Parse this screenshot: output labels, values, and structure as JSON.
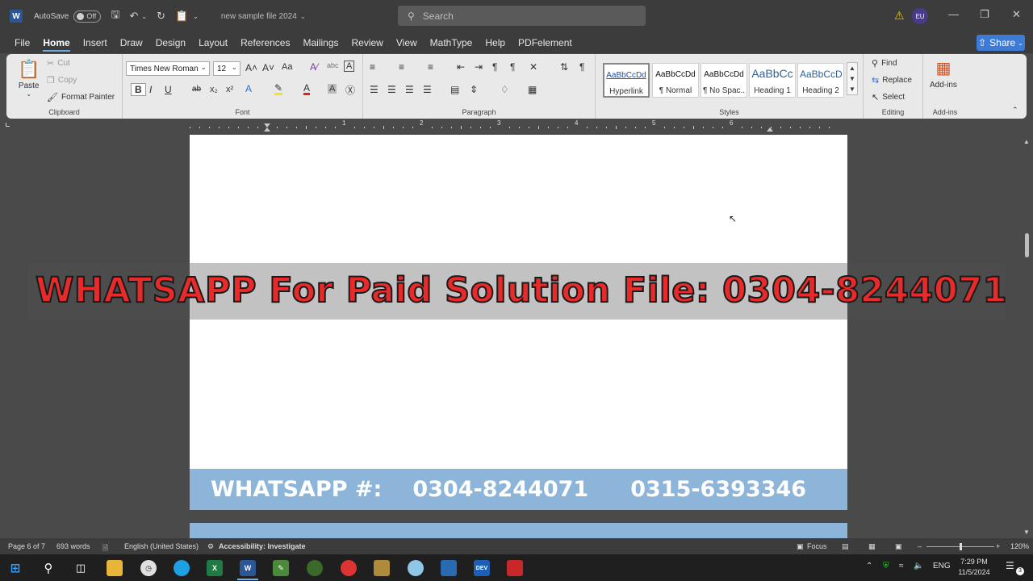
{
  "titlebar": {
    "app_icon": "W",
    "autosave_label": "AutoSave",
    "autosave_state": "Off",
    "doc_title": "new sample file 2024",
    "search_placeholder": "Search",
    "avatar_initials": "EU",
    "icons": [
      "save-icon",
      "undo-icon",
      "redo-icon",
      "clipboard-icon",
      "minimize-icon",
      "restore-icon",
      "close-icon"
    ]
  },
  "menu": {
    "items": [
      "File",
      "Home",
      "Insert",
      "Draw",
      "Design",
      "Layout",
      "References",
      "Mailings",
      "Review",
      "View",
      "MathType",
      "Help",
      "PDFelement"
    ],
    "active": "Home",
    "share_label": "Share"
  },
  "ribbon": {
    "clipboard": {
      "paste": "Paste",
      "cut": "Cut",
      "copy": "Copy",
      "format_painter": "Format Painter",
      "label": "Clipboard"
    },
    "font": {
      "family": "Times New Roman",
      "size": "12",
      "grow": "A˄",
      "shrink": "A˅",
      "case": "Aa",
      "bold": "B",
      "italic": "I",
      "underline": "U",
      "strike": "ab",
      "sub": "x₂",
      "sup": "x²",
      "label": "Font"
    },
    "paragraph": {
      "label": "Paragraph"
    },
    "styles": {
      "items": [
        {
          "preview": "AaBbCcDd",
          "name": "Hyperlink"
        },
        {
          "preview": "AaBbCcDd",
          "name": "¶ Normal"
        },
        {
          "preview": "AaBbCcDd",
          "name": "¶ No Spac..."
        },
        {
          "preview": "AaBbCc",
          "name": "Heading 1"
        },
        {
          "preview": "AaBbCcD",
          "name": "Heading 2"
        }
      ],
      "label": "Styles"
    },
    "editing": {
      "find": "Find",
      "replace": "Replace",
      "select": "Select",
      "label": "Editing"
    },
    "addins": {
      "button": "Add-ins",
      "label": "Add-ins"
    }
  },
  "ruler": {
    "numbers": [
      "1",
      "2",
      "3",
      "4",
      "5",
      "6"
    ]
  },
  "document": {
    "watermark": "WHATSAPP For Paid Solution File: 0304-8244071",
    "banner_label": "WHATSAPP #:",
    "banner_phone1": "0304-8244071",
    "banner_phone2": "0315-6393346"
  },
  "status": {
    "page": "Page 6 of 7",
    "words": "693 words",
    "language": "English (United States)",
    "accessibility": "Accessibility: Investigate",
    "focus": "Focus",
    "zoom": "120%"
  },
  "taskbar": {
    "tray_lang": "ENG",
    "time": "7:29 PM",
    "date": "11/5/2024",
    "notif_count": "3"
  },
  "colors": {
    "word_blue": "#2b5797",
    "watermark_red": "#e82a2a",
    "banner_blue": "#8db4d9",
    "share_blue": "#3e7bd6"
  }
}
